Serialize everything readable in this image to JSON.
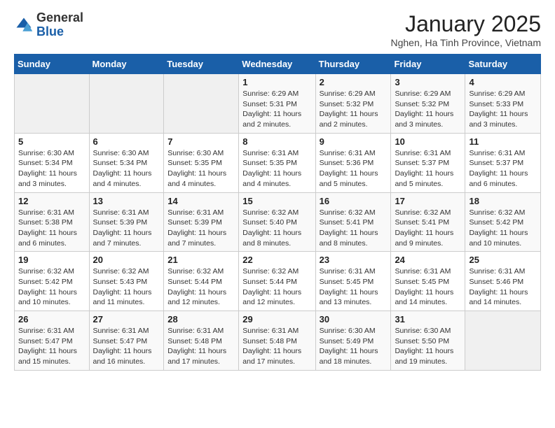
{
  "header": {
    "logo": {
      "general": "General",
      "blue": "Blue"
    },
    "title": "January 2025",
    "location": "Nghen, Ha Tinh Province, Vietnam"
  },
  "weekdays": [
    "Sunday",
    "Monday",
    "Tuesday",
    "Wednesday",
    "Thursday",
    "Friday",
    "Saturday"
  ],
  "weeks": [
    [
      {
        "day": "",
        "info": ""
      },
      {
        "day": "",
        "info": ""
      },
      {
        "day": "",
        "info": ""
      },
      {
        "day": "1",
        "info": "Sunrise: 6:29 AM\nSunset: 5:31 PM\nDaylight: 11 hours and 2 minutes."
      },
      {
        "day": "2",
        "info": "Sunrise: 6:29 AM\nSunset: 5:32 PM\nDaylight: 11 hours and 2 minutes."
      },
      {
        "day": "3",
        "info": "Sunrise: 6:29 AM\nSunset: 5:32 PM\nDaylight: 11 hours and 3 minutes."
      },
      {
        "day": "4",
        "info": "Sunrise: 6:29 AM\nSunset: 5:33 PM\nDaylight: 11 hours and 3 minutes."
      }
    ],
    [
      {
        "day": "5",
        "info": "Sunrise: 6:30 AM\nSunset: 5:34 PM\nDaylight: 11 hours and 3 minutes."
      },
      {
        "day": "6",
        "info": "Sunrise: 6:30 AM\nSunset: 5:34 PM\nDaylight: 11 hours and 4 minutes."
      },
      {
        "day": "7",
        "info": "Sunrise: 6:30 AM\nSunset: 5:35 PM\nDaylight: 11 hours and 4 minutes."
      },
      {
        "day": "8",
        "info": "Sunrise: 6:31 AM\nSunset: 5:35 PM\nDaylight: 11 hours and 4 minutes."
      },
      {
        "day": "9",
        "info": "Sunrise: 6:31 AM\nSunset: 5:36 PM\nDaylight: 11 hours and 5 minutes."
      },
      {
        "day": "10",
        "info": "Sunrise: 6:31 AM\nSunset: 5:37 PM\nDaylight: 11 hours and 5 minutes."
      },
      {
        "day": "11",
        "info": "Sunrise: 6:31 AM\nSunset: 5:37 PM\nDaylight: 11 hours and 6 minutes."
      }
    ],
    [
      {
        "day": "12",
        "info": "Sunrise: 6:31 AM\nSunset: 5:38 PM\nDaylight: 11 hours and 6 minutes."
      },
      {
        "day": "13",
        "info": "Sunrise: 6:31 AM\nSunset: 5:39 PM\nDaylight: 11 hours and 7 minutes."
      },
      {
        "day": "14",
        "info": "Sunrise: 6:31 AM\nSunset: 5:39 PM\nDaylight: 11 hours and 7 minutes."
      },
      {
        "day": "15",
        "info": "Sunrise: 6:32 AM\nSunset: 5:40 PM\nDaylight: 11 hours and 8 minutes."
      },
      {
        "day": "16",
        "info": "Sunrise: 6:32 AM\nSunset: 5:41 PM\nDaylight: 11 hours and 8 minutes."
      },
      {
        "day": "17",
        "info": "Sunrise: 6:32 AM\nSunset: 5:41 PM\nDaylight: 11 hours and 9 minutes."
      },
      {
        "day": "18",
        "info": "Sunrise: 6:32 AM\nSunset: 5:42 PM\nDaylight: 11 hours and 10 minutes."
      }
    ],
    [
      {
        "day": "19",
        "info": "Sunrise: 6:32 AM\nSunset: 5:42 PM\nDaylight: 11 hours and 10 minutes."
      },
      {
        "day": "20",
        "info": "Sunrise: 6:32 AM\nSunset: 5:43 PM\nDaylight: 11 hours and 11 minutes."
      },
      {
        "day": "21",
        "info": "Sunrise: 6:32 AM\nSunset: 5:44 PM\nDaylight: 11 hours and 12 minutes."
      },
      {
        "day": "22",
        "info": "Sunrise: 6:32 AM\nSunset: 5:44 PM\nDaylight: 11 hours and 12 minutes."
      },
      {
        "day": "23",
        "info": "Sunrise: 6:31 AM\nSunset: 5:45 PM\nDaylight: 11 hours and 13 minutes."
      },
      {
        "day": "24",
        "info": "Sunrise: 6:31 AM\nSunset: 5:45 PM\nDaylight: 11 hours and 14 minutes."
      },
      {
        "day": "25",
        "info": "Sunrise: 6:31 AM\nSunset: 5:46 PM\nDaylight: 11 hours and 14 minutes."
      }
    ],
    [
      {
        "day": "26",
        "info": "Sunrise: 6:31 AM\nSunset: 5:47 PM\nDaylight: 11 hours and 15 minutes."
      },
      {
        "day": "27",
        "info": "Sunrise: 6:31 AM\nSunset: 5:47 PM\nDaylight: 11 hours and 16 minutes."
      },
      {
        "day": "28",
        "info": "Sunrise: 6:31 AM\nSunset: 5:48 PM\nDaylight: 11 hours and 17 minutes."
      },
      {
        "day": "29",
        "info": "Sunrise: 6:31 AM\nSunset: 5:48 PM\nDaylight: 11 hours and 17 minutes."
      },
      {
        "day": "30",
        "info": "Sunrise: 6:30 AM\nSunset: 5:49 PM\nDaylight: 11 hours and 18 minutes."
      },
      {
        "day": "31",
        "info": "Sunrise: 6:30 AM\nSunset: 5:50 PM\nDaylight: 11 hours and 19 minutes."
      },
      {
        "day": "",
        "info": ""
      }
    ]
  ]
}
